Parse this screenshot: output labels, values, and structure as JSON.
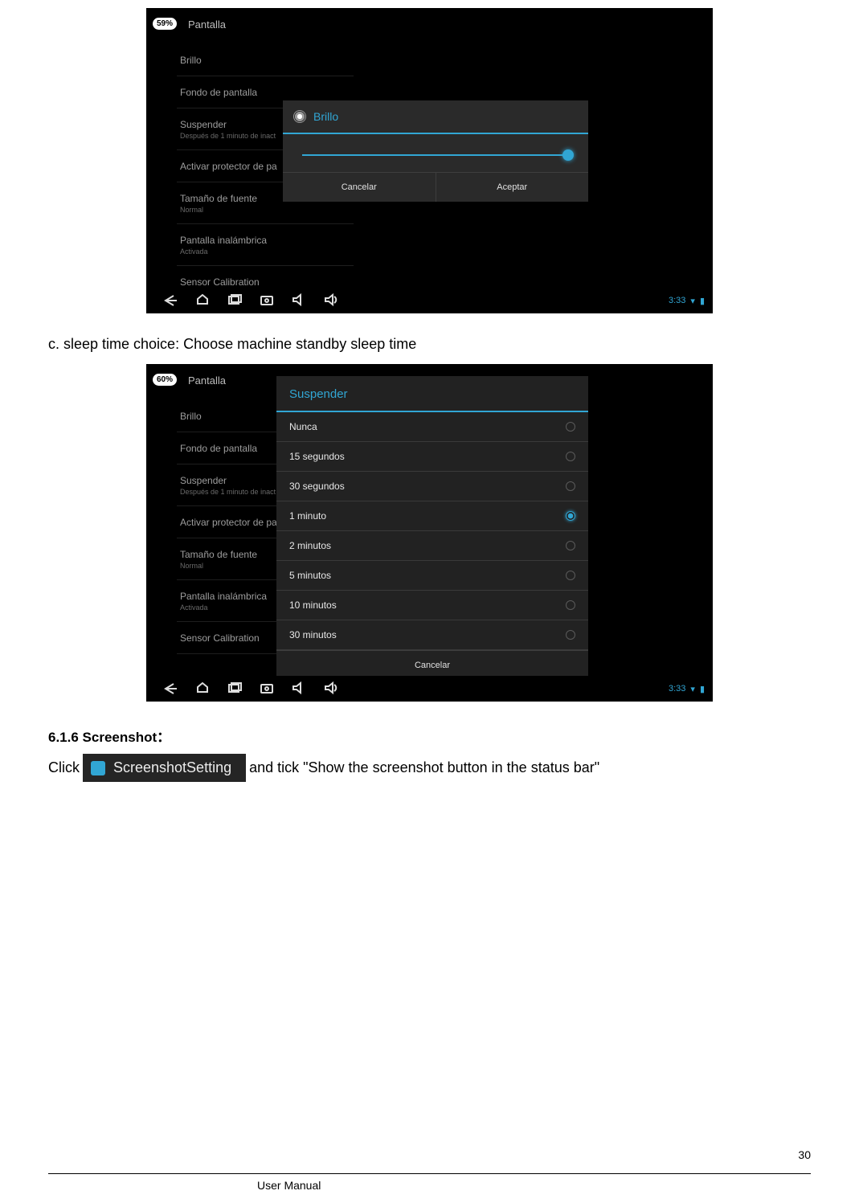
{
  "shot1": {
    "badge": "59%",
    "title": "Pantalla",
    "list": [
      {
        "label": "Brillo",
        "sub": ""
      },
      {
        "label": "Fondo de pantalla",
        "sub": ""
      },
      {
        "label": "Suspender",
        "sub": "Después de 1 minuto de inact"
      },
      {
        "label": "Activar protector de pa",
        "sub": ""
      },
      {
        "label": "Tamaño de fuente",
        "sub": "Normal"
      },
      {
        "label": "Pantalla inalámbrica",
        "sub": "Activada"
      },
      {
        "label": "Sensor Calibration",
        "sub": ""
      }
    ],
    "modal_title": "Brillo",
    "cancel": "Cancelar",
    "accept": "Aceptar",
    "time": "3:33"
  },
  "caption_c": "c. sleep time choice: Choose machine standby sleep time",
  "shot2": {
    "badge": "60%",
    "title": "Pantalla",
    "list": [
      {
        "label": "Brillo",
        "sub": ""
      },
      {
        "label": "Fondo de pantalla",
        "sub": ""
      },
      {
        "label": "Suspender",
        "sub": "Después de 1 minuto de inact"
      },
      {
        "label": "Activar protector de pa",
        "sub": ""
      },
      {
        "label": "Tamaño de fuente",
        "sub": "Normal"
      },
      {
        "label": "Pantalla inalámbrica",
        "sub": "Activada"
      },
      {
        "label": "Sensor Calibration",
        "sub": ""
      }
    ],
    "modal_title": "Suspender",
    "options": [
      {
        "label": "Nunca",
        "selected": false
      },
      {
        "label": "15 segundos",
        "selected": false
      },
      {
        "label": "30 segundos",
        "selected": false
      },
      {
        "label": "1 minuto",
        "selected": true
      },
      {
        "label": "2 minutos",
        "selected": false
      },
      {
        "label": "5 minutos",
        "selected": false
      },
      {
        "label": "10 minutos",
        "selected": false
      },
      {
        "label": "30 minutos",
        "selected": false
      }
    ],
    "cancel": "Cancelar",
    "time": "3:33"
  },
  "section_heading": "6.1.6 Screenshot：",
  "click_text": "Click",
  "ss_button": "ScreenshotSetting",
  "tick_text": " and tick \"Show the screenshot button in the status bar\"",
  "footer": "User Manual",
  "page_number": "30"
}
